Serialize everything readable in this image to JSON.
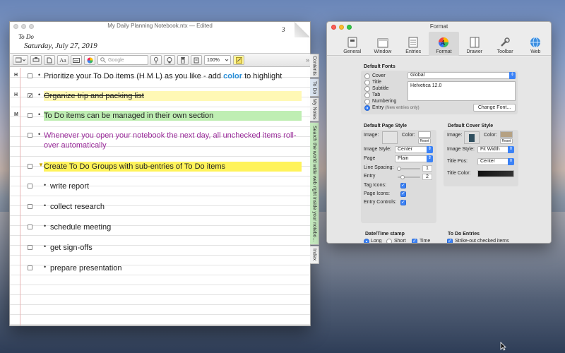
{
  "notebook": {
    "title": "My Daily Planning Notebook.ntx",
    "edited": "— Edited",
    "section": "To Do",
    "date": "Saturday, July 27, 2019",
    "page_number": "3",
    "toolbar": {
      "font_btn": "Aa",
      "search_placeholder": "Google",
      "zoom": "100%",
      "more": "»"
    },
    "entries": [
      {
        "prio": "H",
        "checked": false,
        "text_a": "Prioritize your To Do items (H M L) as you like - add ",
        "text_b": "color",
        "text_c": " to highlight"
      },
      {
        "prio": "H",
        "checked": true,
        "text": "Organize trip and packing list"
      },
      {
        "prio": "M",
        "checked": false,
        "text": "To Do items can be managed in their own section"
      },
      {
        "prio": "",
        "checked": false,
        "text": "Whenever you open your notebook the next day, all unchecked items roll-over automatically"
      },
      {
        "prio": "",
        "checked": false,
        "text": "Create To Do Groups with sub-entries of To Do items"
      },
      {
        "prio": "",
        "checked": false,
        "text": "write report"
      },
      {
        "prio": "",
        "checked": false,
        "text": "collect research"
      },
      {
        "prio": "",
        "checked": false,
        "text": "schedule meeting"
      },
      {
        "prio": "",
        "checked": false,
        "text": "get sign-offs"
      },
      {
        "prio": "",
        "checked": false,
        "text": "prepare presentation"
      }
    ],
    "tabs": [
      "Contents",
      "To Do",
      "My Notes",
      "Search the world wide web right inside your notebo...",
      "Index"
    ]
  },
  "format": {
    "title": "Format",
    "tools": [
      "General",
      "Window",
      "Entries",
      "Format",
      "Drawer",
      "Toolbar",
      "Web"
    ],
    "default_fonts": {
      "title": "Default Fonts",
      "options": [
        "Cover",
        "Title",
        "Subtitle",
        "Tab",
        "Numbering",
        "Entry"
      ],
      "entry_note": "(New entries only)",
      "scope_value": "Global",
      "font_value": "Helvetica 12.0",
      "change_font": "Change Font..."
    },
    "page_style": {
      "title": "Default Page Style",
      "image": "Image:",
      "color": "Color:",
      "reset": "Reset",
      "image_style_label": "Image Style:",
      "image_style_value": "Center",
      "page_label": "Page",
      "page_value": "Plain",
      "line_spacing": "Line Spacing:",
      "line_spacing_value": "1",
      "entry_label": "Entry",
      "entry_value": "2",
      "tag_icons": "Tag Icons:",
      "page_icons": "Page Icons:",
      "entry_controls": "Entry Controls:"
    },
    "cover_style": {
      "title": "Default Cover Style",
      "image": "Image:",
      "color": "Color:",
      "reset": "Reset",
      "image_style_label": "Image Style:",
      "image_style_value": "Fit Width",
      "title_pos_label": "Title Pos:",
      "title_pos_value": "Center",
      "title_color": "Title Color:"
    },
    "datetime": {
      "title": "Date/Time stamp",
      "long": "Long",
      "short": "Short",
      "time": "Time"
    },
    "todo": {
      "title": "To Do Entries",
      "strike": "Strike-out checked items"
    }
  },
  "colors": {
    "highlight_yellow": "#fff8b5",
    "highlight_green": "#bfeeb3",
    "highlight_bright": "#fff35a",
    "purple_text": "#9a2b9a",
    "accent_blue": "#3b82f6"
  }
}
